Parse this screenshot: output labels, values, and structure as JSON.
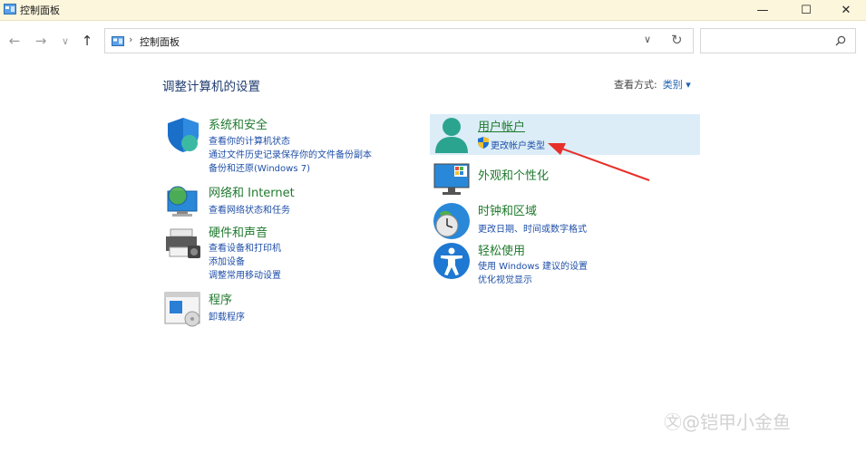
{
  "window": {
    "title": "控制面板",
    "minimize_glyph": "—",
    "maximize_glyph": "☐",
    "close_glyph": "✕"
  },
  "nav": {
    "back_glyph": "←",
    "forward_glyph": "→",
    "recent_glyph": "∨",
    "up_glyph": "↑",
    "address_separator": "›",
    "address_text": "控制面板",
    "address_dropdown_glyph": "∨",
    "refresh_glyph": "↻",
    "search_placeholder": ""
  },
  "heading": "调整计算机的设置",
  "view_by": {
    "label": "查看方式:",
    "value": "类别 ▾"
  },
  "categories": [
    {
      "id": "system-security",
      "title": "系统和安全",
      "links": [
        "查看你的计算机状态",
        "通过文件历史记录保存你的文件备份副本",
        "备份和还原(Windows 7)"
      ],
      "icon": "shield-icon"
    },
    {
      "id": "network",
      "title": "网络和 Internet",
      "links": [
        "查看网络状态和任务"
      ],
      "icon": "network-icon"
    },
    {
      "id": "hardware",
      "title": "硬件和声音",
      "links": [
        "查看设备和打印机",
        "添加设备",
        "调整常用移动设置"
      ],
      "icon": "printer-icon"
    },
    {
      "id": "programs",
      "title": "程序",
      "links": [
        "卸载程序"
      ],
      "icon": "programs-icon"
    },
    {
      "id": "user-accounts",
      "title": "用户帐户",
      "links": [
        "更改帐户类型"
      ],
      "icon": "user-icon"
    },
    {
      "id": "appearance",
      "title": "外观和个性化",
      "links": [],
      "icon": "monitor-icon"
    },
    {
      "id": "clock-region",
      "title": "时钟和区域",
      "links": [
        "更改日期、时间或数字格式"
      ],
      "icon": "clock-globe-icon"
    },
    {
      "id": "ease-of-access",
      "title": "轻松使用",
      "links": [
        "使用 Windows 建议的设置",
        "优化视觉显示"
      ],
      "icon": "accessibility-icon"
    }
  ],
  "watermark": "㉆@铠甲小金鱼",
  "colors": {
    "title_bar": "#fbf6dc",
    "category_title": "#1f7a2e",
    "link": "#1f4fa8",
    "heading": "#1e3a6e",
    "highlight": "#dcedf8",
    "arrow": "#e8302a"
  }
}
